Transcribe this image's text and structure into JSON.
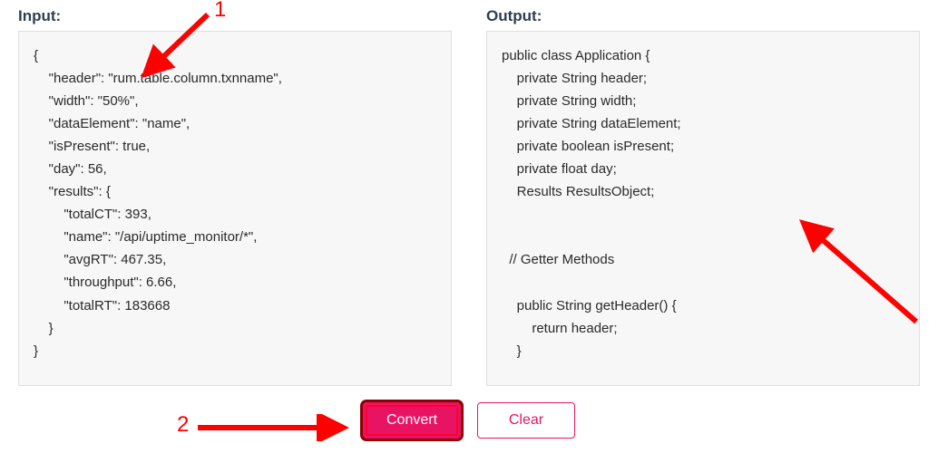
{
  "labels": {
    "input": "Input:",
    "output": "Output:"
  },
  "buttons": {
    "convert": "Convert",
    "clear": "Clear"
  },
  "annotations": {
    "one": "1",
    "two": "2"
  },
  "input_code": "{\n    \"header\": \"rum.table.column.txnname\",\n    \"width\": \"50%\",\n    \"dataElement\": \"name\",\n    \"isPresent\": true,\n    \"day\": 56,\n    \"results\": {\n        \"totalCT\": 393,\n        \"name\": \"/api/uptime_monitor/*\",\n        \"avgRT\": 467.35,\n        \"throughput\": 6.66,\n        \"totalRT\": 183668\n    }\n}",
  "output_code": "public class Application {\n    private String header;\n    private String width;\n    private String dataElement;\n    private boolean isPresent;\n    private float day;\n    Results ResultsObject;\n\n\n  // Getter Methods\n\n    public String getHeader() {\n        return header;\n    }"
}
